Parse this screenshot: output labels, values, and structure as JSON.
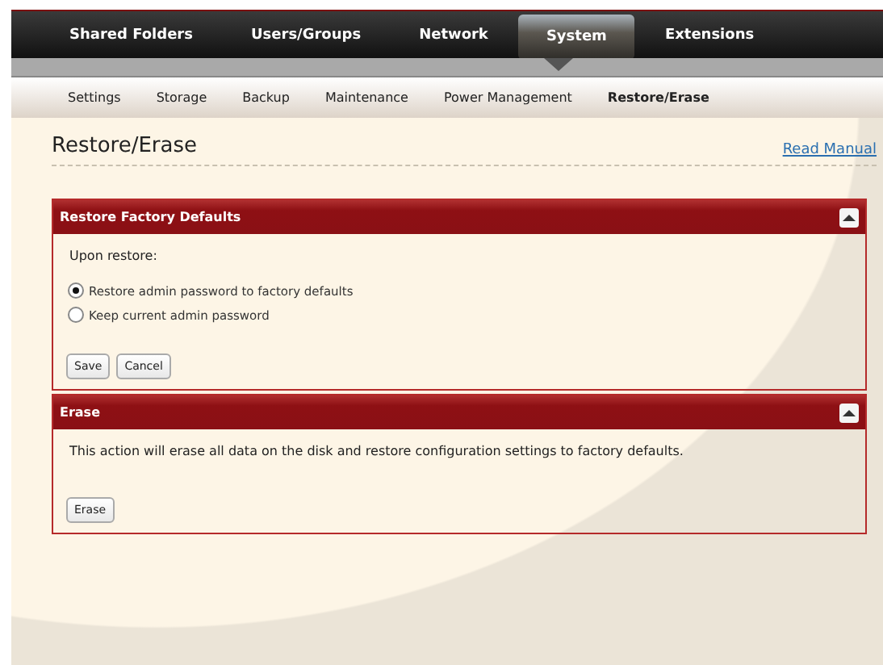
{
  "main_nav": [
    {
      "label": "Shared Folders",
      "selected": false
    },
    {
      "label": "Users/Groups",
      "selected": false
    },
    {
      "label": "Network",
      "selected": false
    },
    {
      "label": "System",
      "selected": true
    },
    {
      "label": "Extensions",
      "selected": false
    }
  ],
  "sub_nav": [
    {
      "label": "Settings",
      "selected": false
    },
    {
      "label": "Storage",
      "selected": false
    },
    {
      "label": "Backup",
      "selected": false
    },
    {
      "label": "Maintenance",
      "selected": false
    },
    {
      "label": "Power Management",
      "selected": false
    },
    {
      "label": "Restore/Erase",
      "selected": true
    }
  ],
  "page_title": "Restore/Erase",
  "read_manual": "Read Manual",
  "panels": [
    {
      "kind": "options",
      "title": "Restore Factory Defaults",
      "expanded": true,
      "prompt": "Upon restore:",
      "options": [
        {
          "label": "Restore admin password to factory defaults",
          "selected": true
        },
        {
          "label": "Keep current admin password",
          "selected": false
        }
      ],
      "buttons": [
        "Save",
        "Cancel"
      ]
    },
    {
      "kind": "message",
      "title": "Erase",
      "expanded": true,
      "message": "This action will erase all data on the disk and restore configuration settings to factory defaults.",
      "buttons": [
        "Erase"
      ]
    }
  ]
}
